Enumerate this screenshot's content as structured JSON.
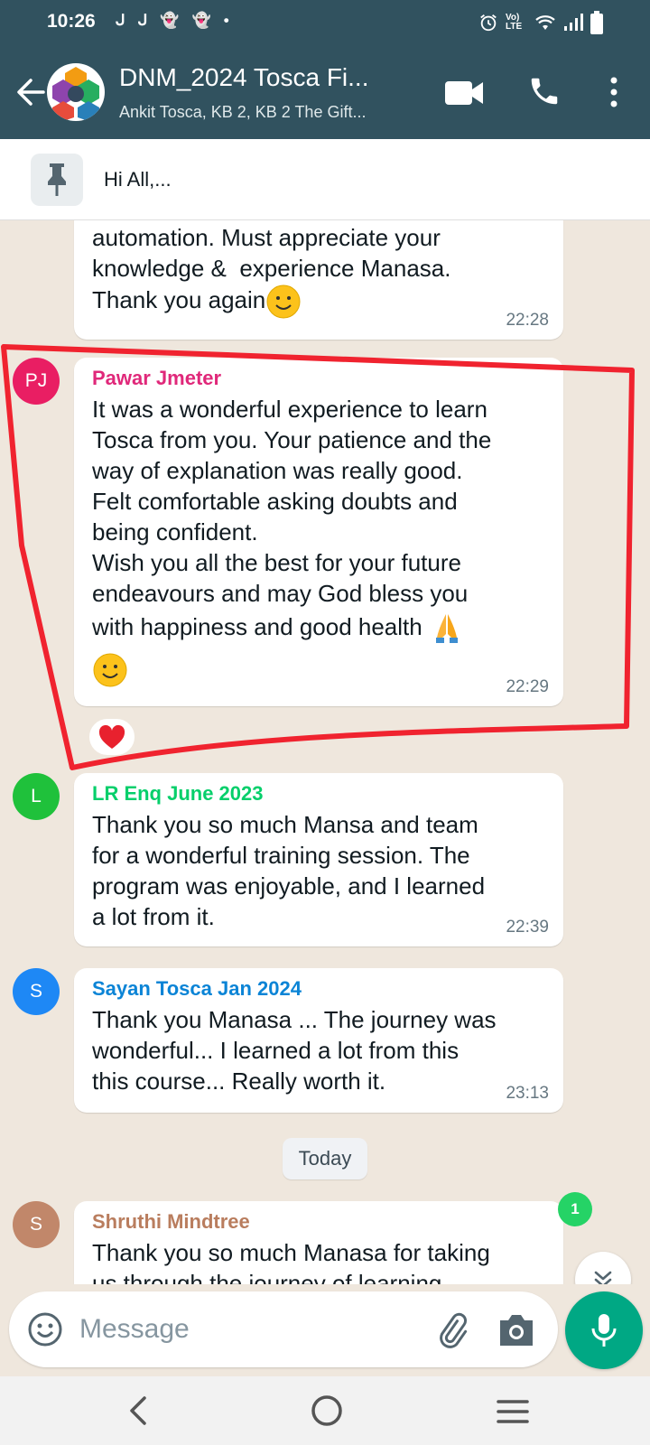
{
  "status_bar": {
    "time": "10:26",
    "left_icons": "ᒍ ᒍ",
    "network_label": "Vo) LTE"
  },
  "header": {
    "title": "DNM_2024 Tosca Fi...",
    "subtitle": "Ankit Tosca, KB 2, KB 2 The Gift..."
  },
  "pinned": {
    "text": "Hi All,..."
  },
  "messages": [
    {
      "text": "automation. Must appreciate your\nknowledge &  experience Manasa.\nThank you again",
      "time": "22:28"
    },
    {
      "initials": "PJ",
      "sender": "Pawar Jmeter",
      "sender_color": "#e0287a",
      "avatar_color": "#e91e63",
      "text_main": "It was a wonderful experience to learn\nTosca from you. Your patience and the\nway of explanation was really good.\nFelt comfortable asking doubts and\nbeing confident.\nWish you all the best for your future\nendeavours and may God bless you",
      "text_last": "with happiness and good health",
      "time": "22:29",
      "reaction": "heart"
    },
    {
      "initials": "L",
      "sender": "LR Enq June 2023",
      "sender_color": "#06cf6b",
      "avatar_color": "#1fc13b",
      "text": "Thank you so much Mansa and team\nfor a wonderful training session. The\nprogram was enjoyable, and I learned\na lot from it.",
      "time": "22:39"
    },
    {
      "initials": "S",
      "sender": "Sayan Tosca Jan 2024",
      "sender_color": "#0b84d6",
      "avatar_color": "#1e88f5",
      "text": "Thank you Manasa ... The journey was\nwonderful... I learned a lot from this\nthis course... Really worth it.",
      "time": "23:13"
    },
    {
      "initials": "S",
      "sender": "Shruthi Mindtree",
      "sender_color": "#b97d5e",
      "avatar_color": "#c1876a",
      "text": "Thank you so much Manasa for taking\nus through the journey of learning"
    }
  ],
  "date_chip": "Today",
  "unread_count": "1",
  "composer": {
    "placeholder": "Message"
  },
  "colors": {
    "header_bg": "#31525f",
    "chat_bg": "#efe7dd",
    "accent": "#00a884",
    "annotation": "#f0232f"
  }
}
